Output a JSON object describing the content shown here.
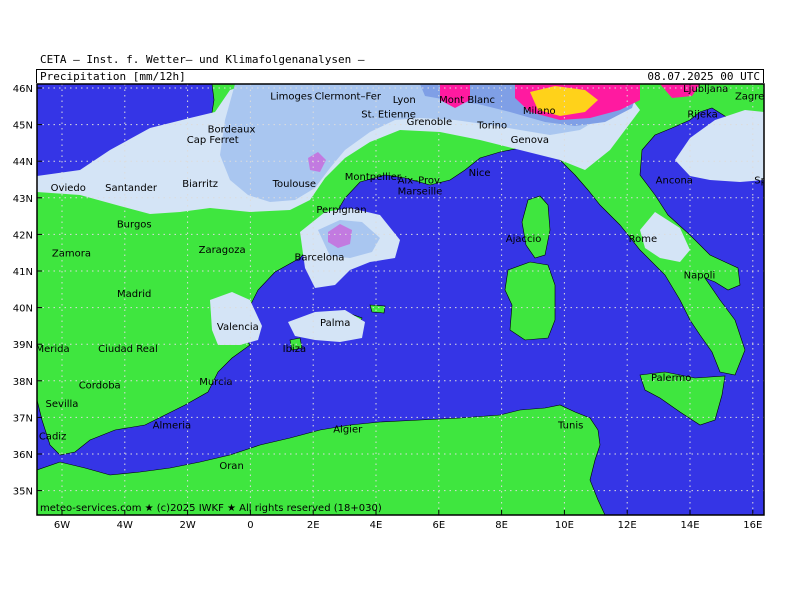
{
  "header": {
    "source": "CETA – Inst. f. Wetter– und Klimafolgenanalysen –",
    "product": "Precipitation [mm/12h]",
    "datetime": "08.07.2025 00 UTC"
  },
  "footer": {
    "credit": "meteo-services.com ★ (c)2025 IWKF ★ All rights reserved (18+030)"
  },
  "axes": {
    "lat_labels": [
      "46N",
      "45N",
      "44N",
      "43N",
      "42N",
      "41N",
      "40N",
      "39N",
      "38N",
      "37N",
      "36N",
      "35N"
    ],
    "lon_labels": [
      "6W",
      "4W",
      "2W",
      "0",
      "2E",
      "4E",
      "6E",
      "8E",
      "10E",
      "12E",
      "14E",
      "16E"
    ]
  },
  "colors": {
    "sea": "#3535e6",
    "land": "#3fe63f",
    "precip_light": "#d4e4f6",
    "precip_mid": "#a9c6f0",
    "precip_heavy": "#7f9fe6",
    "precip_violet": "#c27ae0",
    "precip_magenta": "#ff1aa0",
    "precip_yellow": "#ffd21a"
  },
  "places": [
    {
      "name": "Clermont–Fer",
      "lon": 3.1,
      "lat": 45.8
    },
    {
      "name": "Limoges",
      "lon": 1.3,
      "lat": 45.8
    },
    {
      "name": "Lyon",
      "lon": 4.9,
      "lat": 45.7
    },
    {
      "name": "St. Etienne",
      "lon": 4.4,
      "lat": 45.3
    },
    {
      "name": "Mont Blanc",
      "lon": 6.9,
      "lat": 45.7
    },
    {
      "name": "Milano",
      "lon": 9.2,
      "lat": 45.4
    },
    {
      "name": "Ljubljana",
      "lon": 14.5,
      "lat": 46.0
    },
    {
      "name": "Zagreb",
      "lon": 16.0,
      "lat": 45.8
    },
    {
      "name": "Rijeka",
      "lon": 14.4,
      "lat": 45.3
    },
    {
      "name": "Bordeaux",
      "lon": -0.6,
      "lat": 44.9
    },
    {
      "name": "Grenoble",
      "lon": 5.7,
      "lat": 45.1
    },
    {
      "name": "Torino",
      "lon": 7.7,
      "lat": 45.0
    },
    {
      "name": "Genova",
      "lon": 8.9,
      "lat": 44.6
    },
    {
      "name": "Cap Ferret",
      "lon": -1.2,
      "lat": 44.6
    },
    {
      "name": "Montpellier",
      "lon": 3.9,
      "lat": 43.6
    },
    {
      "name": "Nice",
      "lon": 7.3,
      "lat": 43.7
    },
    {
      "name": "Toulouse",
      "lon": 1.4,
      "lat": 43.4
    },
    {
      "name": "Aix–Prov.",
      "lon": 5.4,
      "lat": 43.5
    },
    {
      "name": "Ancona",
      "lon": 13.5,
      "lat": 43.5
    },
    {
      "name": "Split",
      "lon": 16.4,
      "lat": 43.5
    },
    {
      "name": "Marseille",
      "lon": 5.4,
      "lat": 43.2
    },
    {
      "name": "Oviedo",
      "lon": -5.8,
      "lat": 43.3
    },
    {
      "name": "Santander",
      "lon": -3.8,
      "lat": 43.3
    },
    {
      "name": "Biarritz",
      "lon": -1.6,
      "lat": 43.4
    },
    {
      "name": "Perpignan",
      "lon": 2.9,
      "lat": 42.7
    },
    {
      "name": "Burgos",
      "lon": -3.7,
      "lat": 42.3
    },
    {
      "name": "Ajaccio",
      "lon": 8.7,
      "lat": 41.9
    },
    {
      "name": "Rome",
      "lon": 12.5,
      "lat": 41.9
    },
    {
      "name": "Zaragoza",
      "lon": -0.9,
      "lat": 41.6
    },
    {
      "name": "Barcelona",
      "lon": 2.2,
      "lat": 41.4
    },
    {
      "name": "Zamora",
      "lon": -5.7,
      "lat": 41.5
    },
    {
      "name": "Napoli",
      "lon": 14.3,
      "lat": 40.9
    },
    {
      "name": "Madrid",
      "lon": -3.7,
      "lat": 40.4
    },
    {
      "name": "Palma",
      "lon": 2.7,
      "lat": 39.6
    },
    {
      "name": "Valencia",
      "lon": -0.4,
      "lat": 39.5
    },
    {
      "name": "Merida",
      "lon": -6.3,
      "lat": 38.9
    },
    {
      "name": "Ciudad Real",
      "lon": -3.9,
      "lat": 38.9
    },
    {
      "name": "Ibiza",
      "lon": 1.4,
      "lat": 38.9
    },
    {
      "name": "Cordoba",
      "lon": -4.8,
      "lat": 37.9
    },
    {
      "name": "Murcia",
      "lon": -1.1,
      "lat": 38.0
    },
    {
      "name": "Palermo",
      "lon": 13.4,
      "lat": 38.1
    },
    {
      "name": "Sevilla",
      "lon": -6.0,
      "lat": 37.4
    },
    {
      "name": "Almeria",
      "lon": -2.5,
      "lat": 36.8
    },
    {
      "name": "Algier",
      "lon": 3.1,
      "lat": 36.7
    },
    {
      "name": "Tunis",
      "lon": 10.2,
      "lat": 36.8
    },
    {
      "name": "Cadiz",
      "lon": -6.3,
      "lat": 36.5
    },
    {
      "name": "Oran",
      "lon": -0.6,
      "lat": 35.7
    }
  ]
}
